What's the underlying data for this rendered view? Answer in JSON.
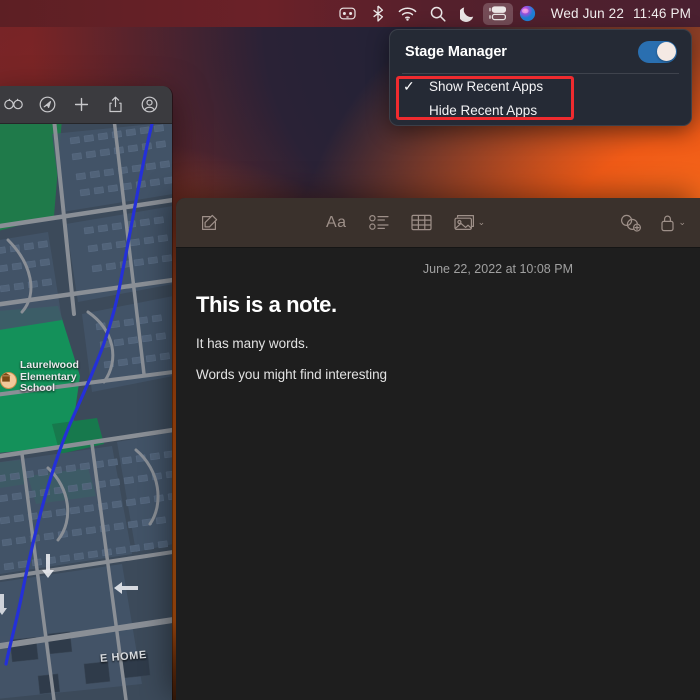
{
  "menubar": {
    "icons": [
      {
        "name": "music-controls-icon"
      },
      {
        "name": "bluetooth-icon"
      },
      {
        "name": "wifi-icon"
      },
      {
        "name": "search-icon"
      },
      {
        "name": "do-not-disturb-icon"
      },
      {
        "name": "stage-manager-icon"
      },
      {
        "name": "siri-icon"
      }
    ],
    "date": "Wed Jun 22",
    "time": "11:46 PM"
  },
  "stage_manager_menu": {
    "title": "Stage Manager",
    "toggle_on": true,
    "toggle_color": "#2a6fb0",
    "items": [
      {
        "label": "Show Recent Apps",
        "checked": true,
        "check_glyph": "✓"
      },
      {
        "label": "Hide Recent Apps",
        "checked": false,
        "check_glyph": ""
      }
    ],
    "highlight_color": "#ef2b2f"
  },
  "maps_window": {
    "toolbar_icons": [
      {
        "name": "look-around-icon"
      },
      {
        "name": "directions-icon"
      },
      {
        "name": "add-icon"
      },
      {
        "name": "share-icon"
      },
      {
        "name": "account-icon"
      }
    ],
    "place_label": "Laurelwood Elementary School",
    "place_pin_glyph": "ἾB",
    "street_label": "E HOME"
  },
  "notes_window": {
    "toolbar_left": [
      {
        "name": "compose-note-icon"
      }
    ],
    "toolbar_middle": [
      {
        "name": "format-text-icon",
        "label": "Aa"
      },
      {
        "name": "checklist-icon"
      },
      {
        "name": "table-icon"
      },
      {
        "name": "media-icon",
        "chevron": "⌄"
      }
    ],
    "toolbar_right": [
      {
        "name": "collaborate-icon"
      },
      {
        "name": "lock-icon",
        "chevron": "⌄"
      }
    ],
    "note": {
      "date": "June 22, 2022 at 10:08 PM",
      "title": "This is a note.",
      "paragraphs": [
        "It has many words.",
        "Words you might find interesting"
      ]
    }
  }
}
